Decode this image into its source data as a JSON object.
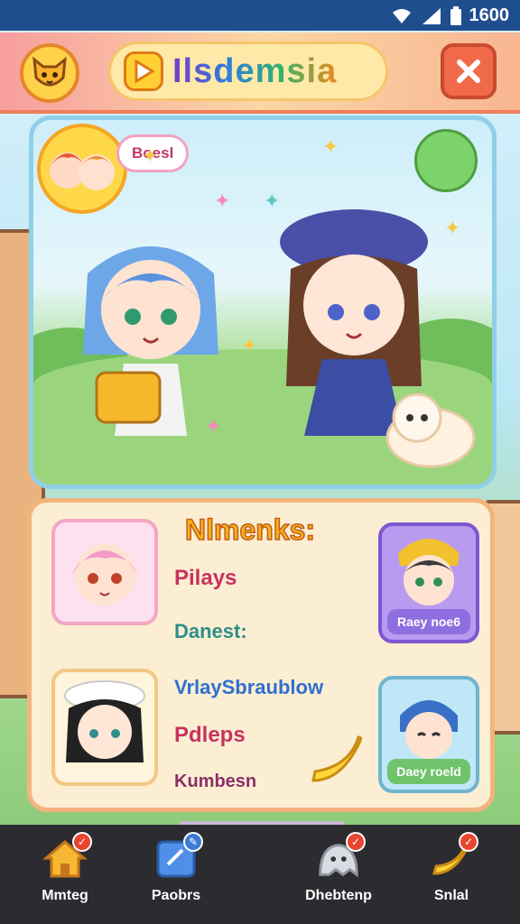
{
  "status_bar": {
    "time": "1600",
    "icons": [
      "wifi-icon",
      "signal-icon",
      "battery-icon"
    ]
  },
  "header": {
    "title": "Ilsdemsia",
    "logo_icon": "fox-mascot-icon",
    "close_icon": "close-icon",
    "play_icon": "play-icon"
  },
  "scene": {
    "players_tag": "Boesl"
  },
  "members": {
    "title": "Nlmenks:",
    "labels": [
      "Pilays",
      "Danest:",
      "VrlaySbraublow",
      "Pdleps",
      "Kumbesn"
    ],
    "cards": [
      {
        "tag": "Raey noe6"
      },
      {
        "tag": "Daey roeld"
      }
    ]
  },
  "nav": {
    "items": [
      {
        "label": "Mmteg",
        "icon": "home-icon",
        "badge": ""
      },
      {
        "label": "Paobrs",
        "icon": "notebook-icon",
        "badge": ""
      },
      {
        "label": "Dhebtenp",
        "icon": "ghost-icon",
        "badge": ""
      },
      {
        "label": "Snlal",
        "icon": "banana-icon",
        "badge": ""
      }
    ]
  },
  "colors": {
    "accent": "#f06a4a",
    "header_gradient_start": "#f79e9e",
    "panel": "#fbeed2",
    "nav_bg": "#2b2b30"
  }
}
